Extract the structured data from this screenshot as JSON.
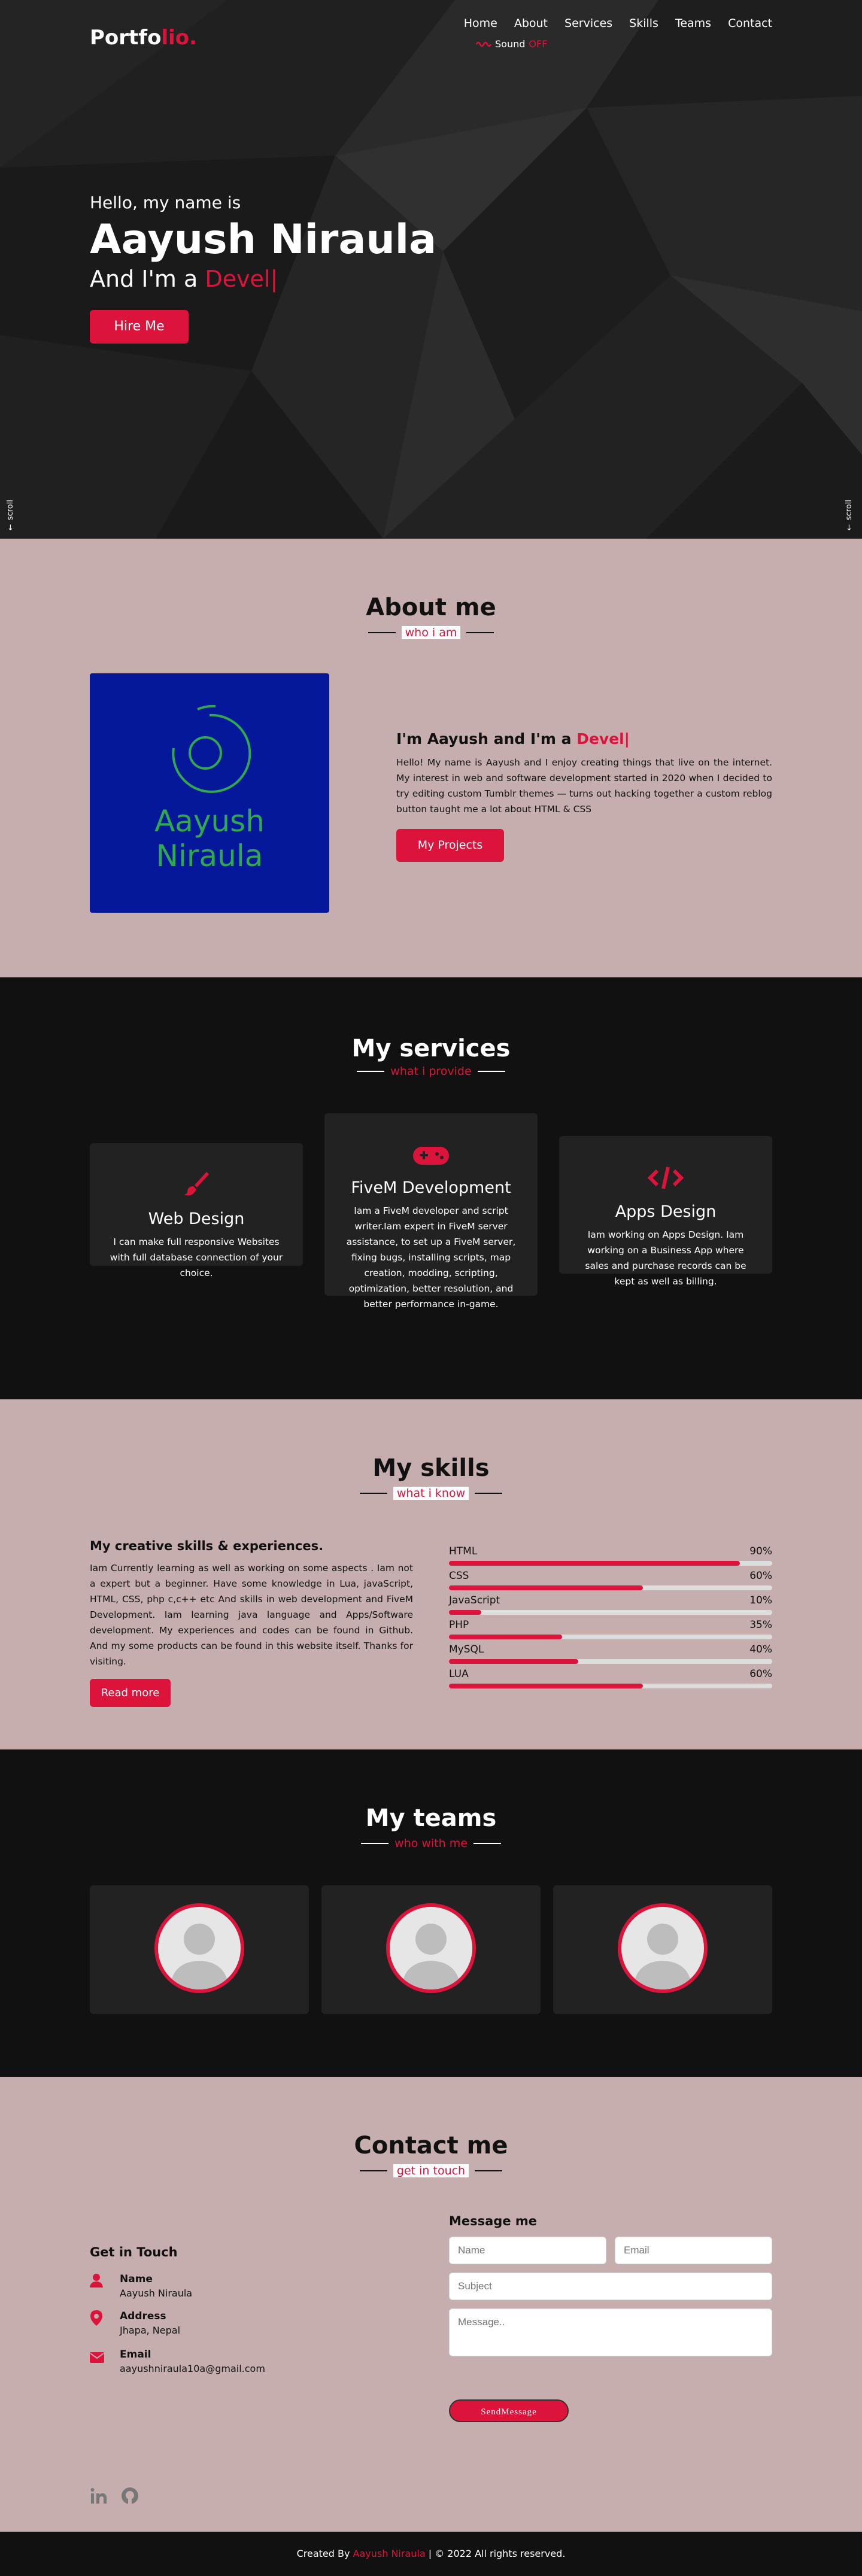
{
  "nav": {
    "logo_main": "Portfo",
    "logo_accent": "lio.",
    "items": [
      "Home",
      "About",
      "Services",
      "Skills",
      "Teams",
      "Contact"
    ],
    "sound_label": "Sound",
    "sound_state": "OFF"
  },
  "hero": {
    "greeting": "Hello, my name is",
    "name": "Aayush Niraula",
    "role_prefix": "And I'm a ",
    "role_typed": "Devel|",
    "hire_button": "Hire Me",
    "scroll_left": "scroll",
    "scroll_right": "scroll"
  },
  "about": {
    "title": "About me",
    "subtitle": "who i am",
    "photo_text_1": "Aayush",
    "photo_text_2": "Niraula",
    "heading_prefix": "I'm Aayush and I'm a ",
    "heading_typed": "Devel|",
    "paragraph": "Hello! My name is Aayush and I enjoy creating things that live on the internet. My interest in web and software development started in 2020 when I decided to try editing custom Tumblr themes — turns out hacking together a custom reblog button taught me a lot about HTML & CSS",
    "projects_button": "My Projects"
  },
  "services": {
    "title": "My services",
    "subtitle": "what i provide",
    "cards": [
      {
        "icon": "paintbrush-icon",
        "title": "Web Design",
        "text": "I can make full responsive Websites with full database connection of your choice."
      },
      {
        "icon": "gamepad-icon",
        "title": "FiveM Development",
        "text": "Iam a FiveM developer and script writer.Iam expert in FiveM server assistance, to set up a FiveM server, fixing bugs, installing scripts, map creation, modding, scripting, optimization, better resolution, and better performance in-game."
      },
      {
        "icon": "code-icon",
        "title": "Apps Design",
        "text": "Iam working on Apps Design. Iam working on a Business App where sales and purchase records can be kept as well as billing."
      }
    ]
  },
  "skills": {
    "title": "My skills",
    "subtitle": "what i know",
    "heading": "My creative skills & experiences.",
    "paragraph": "Iam Currently learning as well as working on some aspects . Iam not a expert but a beginner. Have some knowledge in Lua, javaScript, HTML, CSS, php c,c++ etc And skills in web development and FiveM Development. Iam learning java language and Apps/Software development. My experiences and codes can be found in Github. And my some products can be found in this website itself. Thanks for visiting.",
    "read_more": "Read more",
    "bars": [
      {
        "name": "HTML",
        "label": "90%",
        "value": 0.9
      },
      {
        "name": "CSS",
        "label": "60%",
        "value": 0.6
      },
      {
        "name": "JavaScript",
        "label": "10%",
        "value": 0.1
      },
      {
        "name": "PHP",
        "label": "35%",
        "value": 0.35
      },
      {
        "name": "MySQL",
        "label": "40%",
        "value": 0.4
      },
      {
        "name": "LUA",
        "label": "60%",
        "value": 0.6
      }
    ]
  },
  "teams": {
    "title": "My teams",
    "subtitle": "who with me"
  },
  "contact": {
    "title": "Contact me",
    "subtitle": "get in touch",
    "get_in_touch": "Get in Touch",
    "items": [
      {
        "icon": "user-icon",
        "heading": "Name",
        "value": "Aayush Niraula"
      },
      {
        "icon": "map-pin-icon",
        "heading": "Address",
        "value": "Jhapa, Nepal"
      },
      {
        "icon": "envelope-icon",
        "heading": "Email",
        "value": "aayushniraula10a@gmail.com"
      }
    ],
    "form_heading": "Message me",
    "name_placeholder": "Name",
    "email_placeholder": "Email",
    "subject_placeholder": "Subject",
    "message_placeholder": "Message..",
    "send_button": "SendMessage"
  },
  "footer": {
    "prefix": "Created By ",
    "author": "Aayush Niraula",
    "suffix": " | © 2022 All rights reserved."
  },
  "colors": {
    "accent": "#dc143c",
    "light_section": "#c6aeae",
    "dark_section": "#111111",
    "card": "#222222",
    "photo_bg": "#06189a"
  }
}
